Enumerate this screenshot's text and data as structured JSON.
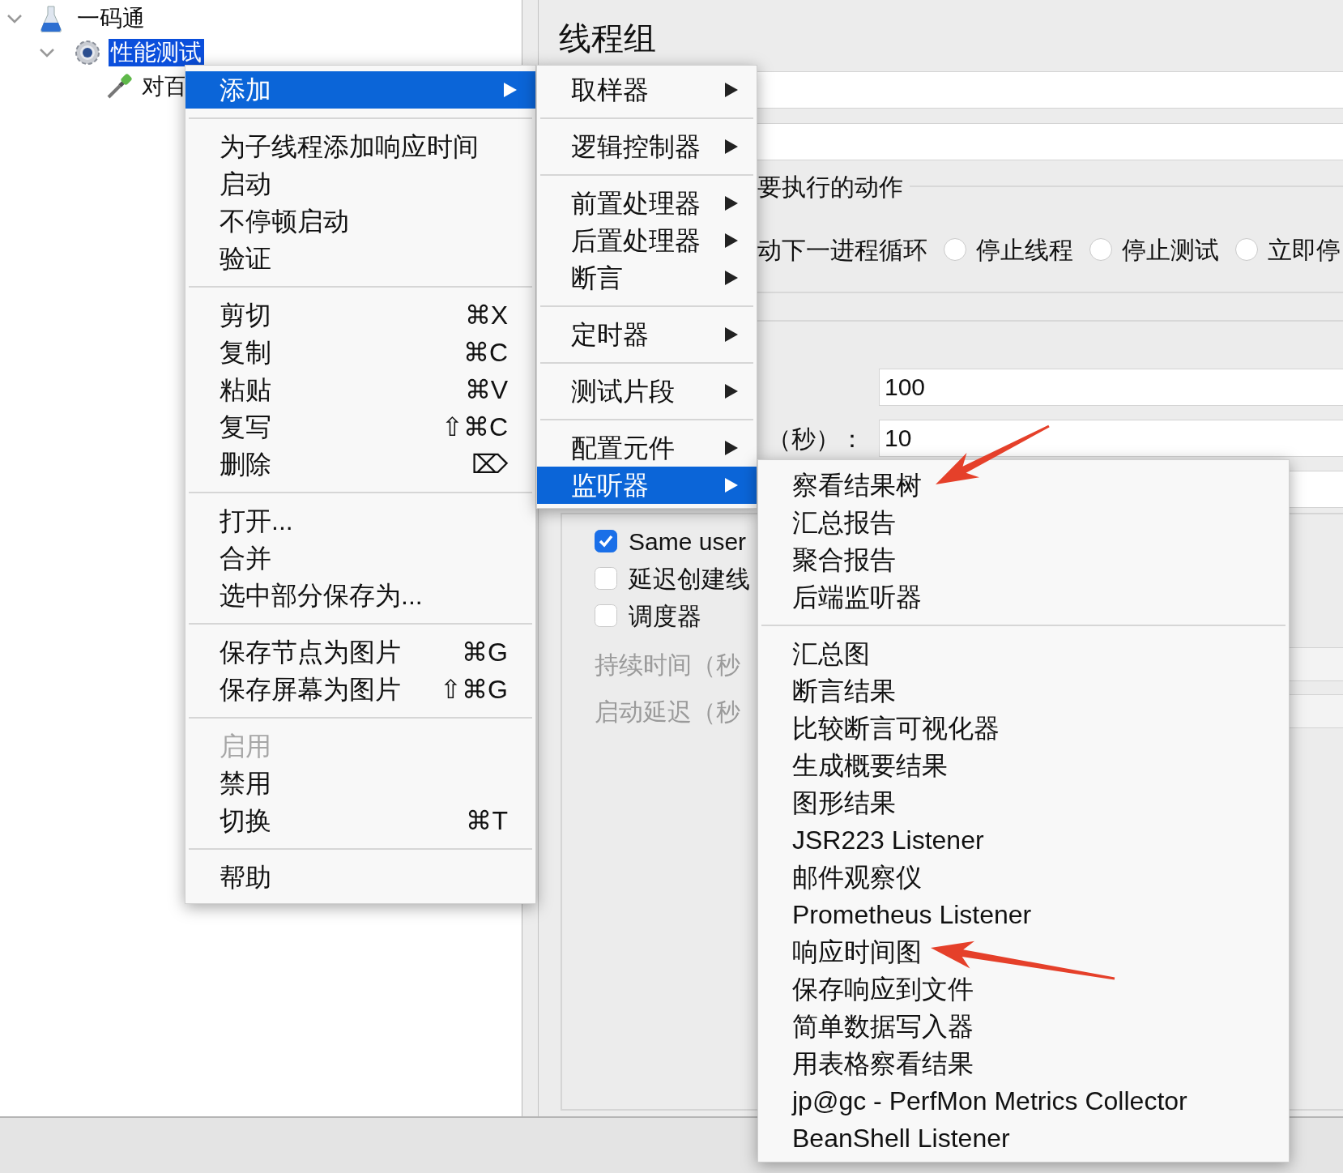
{
  "tree": [
    {
      "label": "一码通",
      "kind": "test-plan",
      "expanded": true,
      "selected": false,
      "children": [
        {
          "label": "性能测试",
          "kind": "thread-group",
          "expanded": true,
          "selected": true,
          "children": [
            {
              "label": "对百",
              "kind": "sampler",
              "selected": false
            }
          ]
        }
      ]
    }
  ],
  "panel": {
    "title": "线程组",
    "error_action": {
      "legend": "要执行的动作",
      "cut_text": "动下一进程循环",
      "options": [
        {
          "label": "停止线程",
          "selected": false
        },
        {
          "label": "停止测试",
          "selected": false
        },
        {
          "label": "立即停",
          "selected": false
        }
      ]
    },
    "rows": [
      {
        "value": "100"
      },
      {
        "label": "（秒）：",
        "value": "10"
      }
    ],
    "checkboxes": [
      {
        "label": "Same user",
        "checked": true
      },
      {
        "label": "延迟创建线",
        "checked": false
      },
      {
        "label": "调度器",
        "checked": false
      }
    ],
    "schedule_fields": [
      {
        "label": "持续时间（秒",
        "disabled": true
      },
      {
        "label": "启动延迟（秒",
        "disabled": true
      }
    ]
  },
  "context_menu": {
    "groups": [
      [
        {
          "label": "添加",
          "selected": true,
          "submenu": true,
          "disabled": false
        }
      ],
      [
        {
          "label": "为子线程添加响应时间",
          "selected": false,
          "disabled": false
        },
        {
          "label": "启动",
          "selected": false,
          "disabled": false
        },
        {
          "label": "不停顿启动",
          "selected": false,
          "disabled": false
        },
        {
          "label": "验证",
          "selected": false,
          "disabled": false
        }
      ],
      [
        {
          "label": "剪切",
          "shortcut": "⌘X",
          "selected": false,
          "disabled": false
        },
        {
          "label": "复制",
          "shortcut": "⌘C",
          "selected": false,
          "disabled": false
        },
        {
          "label": "粘贴",
          "shortcut": "⌘V",
          "selected": false,
          "disabled": false
        },
        {
          "label": "复写",
          "shortcut": "⇧⌘C",
          "selected": false,
          "disabled": false
        },
        {
          "label": "删除",
          "shortcut": "⌦",
          "selected": false,
          "disabled": false
        }
      ],
      [
        {
          "label": "打开...",
          "selected": false,
          "disabled": false
        },
        {
          "label": "合并",
          "selected": false,
          "disabled": false
        },
        {
          "label": "选中部分保存为...",
          "selected": false,
          "disabled": false
        }
      ],
      [
        {
          "label": "保存节点为图片",
          "shortcut": "⌘G",
          "selected": false,
          "disabled": false
        },
        {
          "label": "保存屏幕为图片",
          "shortcut": "⇧⌘G",
          "selected": false,
          "disabled": false
        }
      ],
      [
        {
          "label": "启用",
          "selected": false,
          "disabled": true
        },
        {
          "label": "禁用",
          "selected": false,
          "disabled": false
        },
        {
          "label": "切换",
          "shortcut": "⌘T",
          "selected": false,
          "disabled": false
        }
      ],
      [
        {
          "label": "帮助",
          "selected": false,
          "disabled": false
        }
      ]
    ]
  },
  "add_submenu": {
    "groups": [
      [
        {
          "label": "取样器",
          "selected": false,
          "submenu": true
        }
      ],
      [
        {
          "label": "逻辑控制器",
          "selected": false,
          "submenu": true
        }
      ],
      [
        {
          "label": "前置处理器",
          "selected": false,
          "submenu": true
        },
        {
          "label": "后置处理器",
          "selected": false,
          "submenu": true
        },
        {
          "label": "断言",
          "selected": false,
          "submenu": true
        }
      ],
      [
        {
          "label": "定时器",
          "selected": false,
          "submenu": true
        }
      ],
      [
        {
          "label": "测试片段",
          "selected": false,
          "submenu": true
        }
      ],
      [
        {
          "label": "配置元件",
          "selected": false,
          "submenu": true
        },
        {
          "label": "监听器",
          "selected": true,
          "submenu": true
        }
      ]
    ]
  },
  "listener_submenu": {
    "groups": [
      [
        {
          "label": "察看结果树",
          "selected": false,
          "arrow": true
        },
        {
          "label": "汇总报告",
          "selected": false
        },
        {
          "label": "聚合报告",
          "selected": false
        },
        {
          "label": "后端监听器",
          "selected": false
        }
      ],
      [
        {
          "label": "汇总图",
          "selected": false
        },
        {
          "label": "断言结果",
          "selected": false
        },
        {
          "label": "比较断言可视化器",
          "selected": false
        },
        {
          "label": "生成概要结果",
          "selected": false
        },
        {
          "label": "图形结果",
          "selected": false
        },
        {
          "label": "JSR223 Listener",
          "selected": false
        },
        {
          "label": "邮件观察仪",
          "selected": false
        },
        {
          "label": "Prometheus Listener",
          "selected": false
        },
        {
          "label": "响应时间图",
          "selected": false,
          "arrow": true
        },
        {
          "label": "保存响应到文件",
          "selected": false
        },
        {
          "label": "简单数据写入器",
          "selected": false
        },
        {
          "label": "用表格察看结果",
          "selected": false
        },
        {
          "label": "jp@gc - PerfMon Metrics Collector",
          "selected": false
        },
        {
          "label": "BeanShell Listener",
          "selected": false
        }
      ]
    ]
  }
}
